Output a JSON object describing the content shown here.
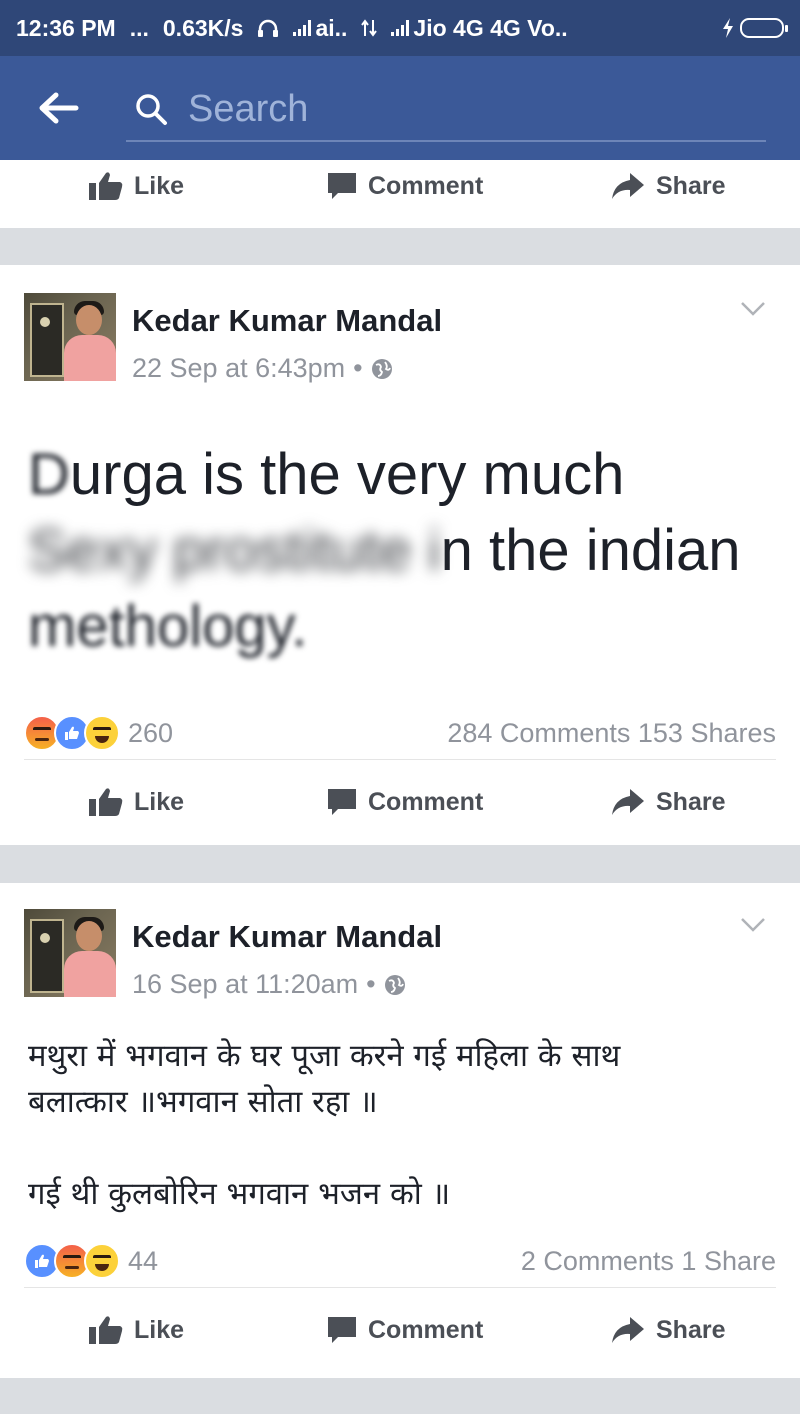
{
  "status_bar": {
    "time": "12:36 PM",
    "dots": "...",
    "speed": "0.63K/s",
    "carrier1": "ai..",
    "carrier2": "Jio 4G 4G Vo..",
    "battery_color": "#5ed03f"
  },
  "app_bar": {
    "back_icon": "arrow-left-icon",
    "search_placeholder": "Search",
    "bg_color": "#3b5998"
  },
  "actions": {
    "like_label": "Like",
    "comment_label": "Comment",
    "share_label": "Share"
  },
  "posts": [
    {
      "author": "Kedar Kumar Mandal",
      "timestamp": "22 Sep at 6:43pm",
      "privacy_icon": "globe-icon",
      "text_line1_blurred_part": "D",
      "text_line1_rest": "urga is the very much",
      "text_line2_blurred": "Sexy prostitute i",
      "text_line2_rest": "n the indian",
      "text_line3": "methology.",
      "reactions": [
        "angry",
        "like",
        "haha"
      ],
      "reaction_count": "260",
      "comments_shares": "284 Comments 153 Shares"
    },
    {
      "author": "Kedar Kumar Mandal",
      "timestamp": "16 Sep at 11:20am",
      "privacy_icon": "globe-icon",
      "text": "मथुरा में भगवान के घर पूजा करने गई महिला के साथ\nबलात्कार ॥भगवान सोता रहा ॥\n\nगई थी कुलबोरिन भगवान भजन को ॥",
      "reactions": [
        "like",
        "angry",
        "haha"
      ],
      "reaction_count": "44",
      "comments_shares": "2 Comments 1 Share"
    }
  ]
}
